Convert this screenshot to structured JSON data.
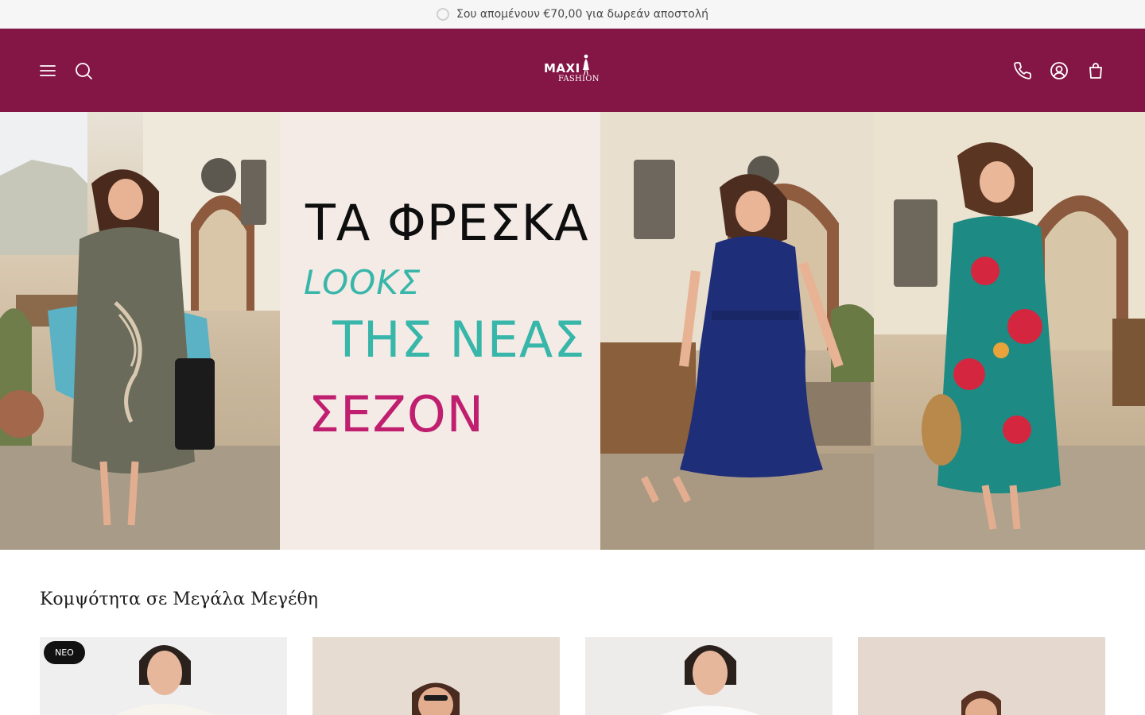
{
  "announcement": {
    "text": "Σου απομένουν €70,00 για δωρεάν αποστολή"
  },
  "header": {
    "logo_word": "MAXI",
    "logo_sub": "FASHION",
    "icons": [
      "menu-icon",
      "search-icon",
      "phone-icon",
      "account-icon",
      "cart-icon"
    ],
    "background_color": "#841646"
  },
  "hero": {
    "line1": "ΤΑ ΦΡΕΣΚΑ",
    "line2": "LOOKΣ",
    "line3": "ΤΗΣ ΝΕΑΣ",
    "line4": "ΣΕΖΟΝ",
    "colors": {
      "line1": "#0e0e0e",
      "line2": "#37b6a9",
      "line3": "#37b6a9",
      "line4": "#c01e6f"
    }
  },
  "collection": {
    "title": "Κομψότητα σε Μεγάλα Μεγέθη",
    "products": [
      {
        "badge": "ΝΕΟ"
      },
      {
        "badge": ""
      },
      {
        "badge": ""
      },
      {
        "badge": ""
      }
    ]
  }
}
